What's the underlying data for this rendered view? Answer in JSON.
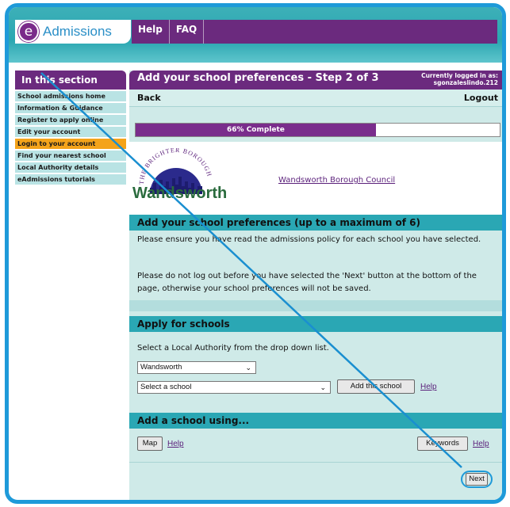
{
  "brand": {
    "letter": "e",
    "name": "Admissions"
  },
  "top_nav": [
    "Help",
    "FAQ"
  ],
  "sidebar": {
    "heading": "In this section",
    "items": [
      {
        "label": "School admissions home",
        "active": false
      },
      {
        "label": "Information & Guidance",
        "active": false
      },
      {
        "label": "Register to apply online",
        "active": false
      },
      {
        "label": "Edit your account",
        "active": false
      },
      {
        "label": "Login to your account",
        "active": true
      },
      {
        "label": "Find your nearest school",
        "active": false
      },
      {
        "label": "Local Authority details",
        "active": false
      },
      {
        "label": "eAdmissions tutorials",
        "active": false
      }
    ]
  },
  "header": {
    "title": "Add your school preferences - Step 2 of 3",
    "login_line1": "Currently logged in as:",
    "login_user": "sgonzaleslindo.212",
    "back": "Back",
    "logout": "Logout"
  },
  "progress": {
    "label": "66% Complete",
    "fraction": 0.66
  },
  "council": {
    "arc_text": "THE BRIGHTER BOROUGH",
    "logo_word": "Wandsworth",
    "link": "Wandsworth Borough Council"
  },
  "preferences": {
    "heading": "Add your school preferences (up to a maximum of 6)",
    "para1": "Please ensure you have read the admissions policy for each school you have selected.",
    "para2": "Please do not log out before you have selected the 'Next' button at the bottom of the page, otherwise your school preferences will not be saved."
  },
  "apply": {
    "heading": "Apply for schools",
    "instruction": "Select a Local Authority from the drop down list.",
    "authority_value": "Wandsworth",
    "school_placeholder": "Select a school",
    "add_button": "Add this school",
    "help": "Help"
  },
  "add_using": {
    "heading": "Add a school using...",
    "map_button": "Map",
    "map_help": "Help",
    "keywords_button": "Keywords",
    "keywords_help": "Help"
  },
  "next_button": "Next",
  "colors": {
    "frame": "#1e9ad9",
    "purple": "#6b2a7e",
    "teal": "#2aa7b4",
    "active_orange": "#f4a31a",
    "annotation_line": "#1a8fd0"
  }
}
